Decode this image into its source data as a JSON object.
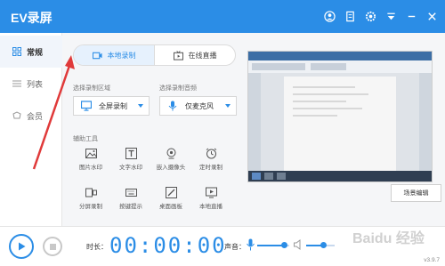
{
  "app": {
    "title": "EV录屏",
    "version": "v3.9.7"
  },
  "sidebar": {
    "items": [
      {
        "label": "常规",
        "icon": "grid-icon",
        "active": true
      },
      {
        "label": "列表",
        "icon": "list-icon",
        "active": false
      },
      {
        "label": "会员",
        "icon": "member-icon",
        "active": false
      }
    ]
  },
  "tabs": [
    {
      "label": "本地录制",
      "icon": "video-icon",
      "active": true
    },
    {
      "label": "在线直播",
      "icon": "live-icon",
      "active": false
    }
  ],
  "record_area": {
    "label": "选择录制区域",
    "value": "全屏录制"
  },
  "record_audio": {
    "label": "选择录制音频",
    "value": "仅麦克风"
  },
  "tools": {
    "label": "辅助工具",
    "items": [
      {
        "label": "图片水印",
        "icon": "image-icon"
      },
      {
        "label": "文字水印",
        "icon": "text-icon"
      },
      {
        "label": "嵌入摄像头",
        "icon": "webcam-icon"
      },
      {
        "label": "定时录制",
        "icon": "alarm-icon"
      },
      {
        "label": "分屏录制",
        "icon": "split-screen-icon"
      },
      {
        "label": "按键提示",
        "icon": "keyboard-icon"
      },
      {
        "label": "桌面画板",
        "icon": "pen-icon"
      },
      {
        "label": "本地直播",
        "icon": "play-screen-icon"
      }
    ]
  },
  "scene_button": "场景编辑",
  "bottom": {
    "duration_label": "时长：",
    "timer": "00:00:00",
    "volume_label": "声音：",
    "mic_volume": 0.85,
    "speaker_volume": 0.6
  },
  "watermark": "Baidu 经验",
  "colors": {
    "accent": "#2b8de6",
    "annotation_arrow": "#e03a3a"
  }
}
